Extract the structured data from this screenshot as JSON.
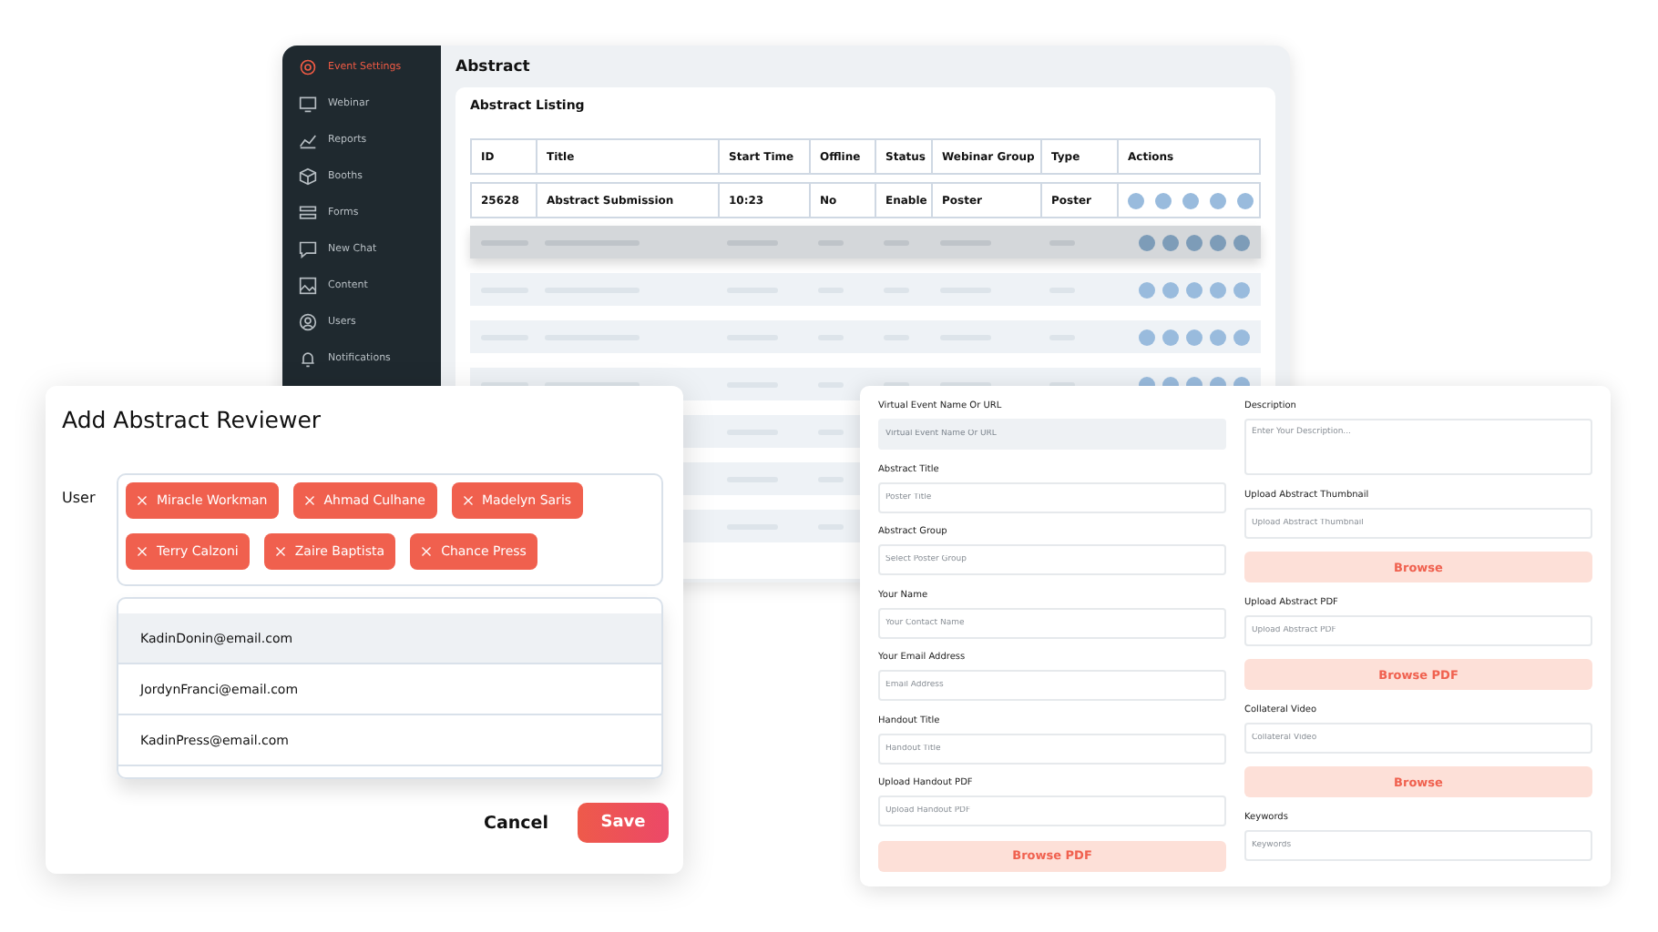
{
  "sidebar": {
    "items": [
      {
        "label": "Event Settings",
        "selected": true
      },
      {
        "label": "Webinar",
        "selected": false
      },
      {
        "label": "Reports",
        "selected": false
      },
      {
        "label": "Booths",
        "selected": false
      },
      {
        "label": "Forms",
        "selected": false
      },
      {
        "label": "New Chat",
        "selected": false
      },
      {
        "label": "Content",
        "selected": false
      },
      {
        "label": "Users",
        "selected": false
      },
      {
        "label": "Notifications",
        "selected": false
      }
    ]
  },
  "page": {
    "title": "Abstract",
    "card_title": "Abstract Listing"
  },
  "table": {
    "columns": [
      "ID",
      "Title",
      "Start Time",
      "Offline",
      "Status",
      "Webinar Group",
      "Type",
      "Actions"
    ],
    "rows": [
      {
        "cells": [
          "25628",
          "Abstract Submission",
          "10:23",
          "No",
          "Enable",
          "Poster",
          "Poster"
        ]
      }
    ],
    "loading_rows": [
      {
        "selected": true
      },
      {
        "selected": false
      },
      {
        "selected": false
      },
      {
        "selected": false
      },
      {
        "selected": false
      },
      {
        "selected": false
      },
      {
        "selected": false
      }
    ]
  },
  "reviewer_dialog": {
    "title": "Add Abstract Reviewer",
    "field_label": "User",
    "tags": [
      "Miracle Workman",
      "Ahmad Culhane",
      "Madelyn Saris",
      "Terry Calzoni",
      "Zaire Baptista",
      "Chance Press"
    ],
    "options": [
      {
        "label": "KadinDonin@email.com",
        "selected": true
      },
      {
        "label": "JordynFranci@email.com",
        "selected": false
      },
      {
        "label": "KadinPress@email.com",
        "selected": false
      }
    ],
    "buttons": {
      "cancel": "Cancel",
      "save": "Save"
    }
  },
  "abstract_form": {
    "columns": [
      [
        {
          "kind": "input",
          "label": "Virtual Event Name Or URL",
          "placeholder": "Virtual Event Name Or URL",
          "disabled": true
        },
        {
          "kind": "input",
          "label": "Abstract Title",
          "placeholder": "Poster Title",
          "disabled": false
        },
        {
          "kind": "input",
          "label": "Abstract Group",
          "placeholder": "Select Poster Group",
          "disabled": false
        },
        {
          "kind": "input",
          "label": "Your Name",
          "placeholder": "Your Contact Name",
          "disabled": false
        },
        {
          "kind": "input",
          "label": "Your Email Address",
          "placeholder": "Email Address",
          "disabled": false
        },
        {
          "kind": "input",
          "label": "Handout Title",
          "placeholder": "Handout Title",
          "disabled": false
        },
        {
          "kind": "input",
          "label": "Upload Handout PDF",
          "placeholder": "Upload Handout PDF",
          "disabled": false
        },
        {
          "kind": "button",
          "label": "Browse PDF"
        }
      ],
      [
        {
          "kind": "textarea",
          "label": "Description",
          "placeholder": "Enter Your Description...",
          "disabled": false
        },
        {
          "kind": "input",
          "label": "Upload Abstract Thumbnail",
          "placeholder": "Upload Abstract Thumbnail",
          "disabled": false
        },
        {
          "kind": "button",
          "label": "Browse"
        },
        {
          "kind": "input",
          "label": "Upload Abstract PDF",
          "placeholder": "Upload Abstract PDF",
          "disabled": false
        },
        {
          "kind": "button",
          "label": "Browse PDF"
        },
        {
          "kind": "input",
          "label": "Collateral Video",
          "placeholder": "Collateral Video",
          "disabled": false
        },
        {
          "kind": "button",
          "label": "Browse"
        },
        {
          "kind": "input",
          "label": "Keywords",
          "placeholder": "Keywords",
          "disabled": false
        }
      ]
    ]
  }
}
